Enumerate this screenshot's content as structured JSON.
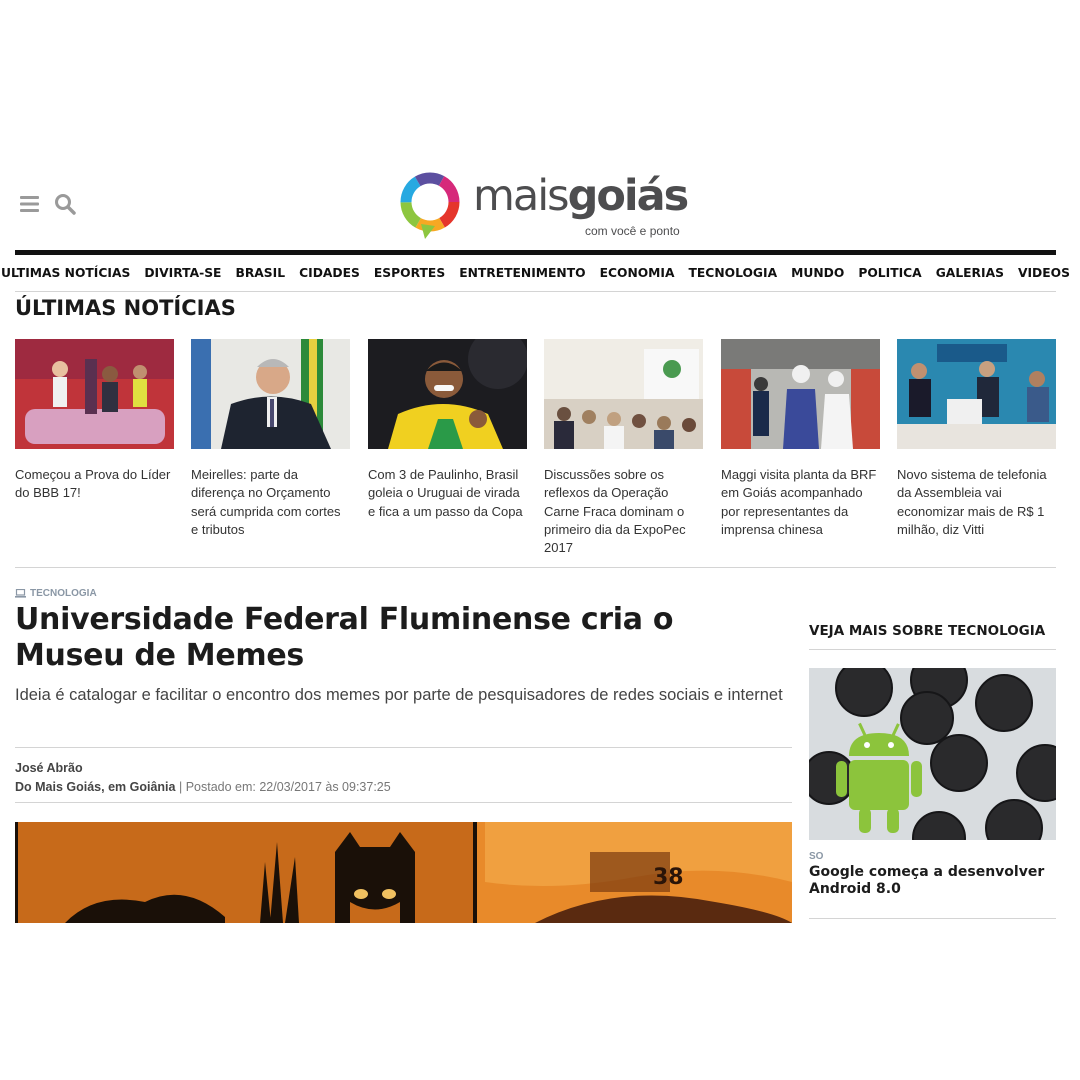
{
  "header": {
    "logo_light": "mais",
    "logo_bold": "goiás",
    "logo_tagline": "com você e ponto",
    "menu_icon": "hamburger-menu-icon",
    "search_icon": "search-icon"
  },
  "nav": {
    "items": [
      "ULTIMAS NOTÍCIAS",
      "DIVIRTA-SE",
      "BRASIL",
      "CIDADES",
      "ESPORTES",
      "ENTRETENIMENTO",
      "ECONOMIA",
      "TECNOLOGIA",
      "MUNDO",
      "POLITICA",
      "GALERIAS",
      "VIDEOS"
    ]
  },
  "latest": {
    "title": "ÚLTIMAS NOTÍCIAS",
    "items": [
      {
        "headline": "Começou a Prova do Líder do BBB 17!"
      },
      {
        "headline": "Meirelles: parte da diferença no Orçamento será cumprida com cortes e tributos"
      },
      {
        "headline": "Com 3 de Paulinho, Brasil goleia o Uruguai de virada e fica a um passo da Copa"
      },
      {
        "headline": "Discussões sobre os reflexos da Operação Carne Fraca dominam o primeiro dia da ExpoPec 2017"
      },
      {
        "headline": "Maggi visita planta da BRF em Goiás acompanhado por representantes da imprensa chinesa"
      },
      {
        "headline": "Novo sistema de telefonia da Assembleia vai economizar mais de R$ 1 milhão, diz Vitti"
      }
    ]
  },
  "article": {
    "category": "TECNOLOGIA",
    "category_icon": "laptop-icon",
    "title": "Universidade Federal Fluminense cria o Museu de Memes",
    "subtitle": "Ideia é catalogar e facilitar o encontro dos memes por parte de pesquisadores de redes sociais e internet",
    "author": "José Abrão",
    "source": "Do Mais Goiás, em Goiânia",
    "separator": "|",
    "posted": "Postado em: 22/03/2017 às 09:37:25"
  },
  "sidebar": {
    "title": "VEJA MAIS SOBRE TECNOLOGIA",
    "card": {
      "category": "SO",
      "title": "Google começa a desenvolver Android 8.0"
    }
  },
  "colors": {
    "nav_bar": "#111111",
    "category_gray": "#8a97a5",
    "text_dark": "#1c1c1c",
    "divider": "#d4d4d4"
  }
}
